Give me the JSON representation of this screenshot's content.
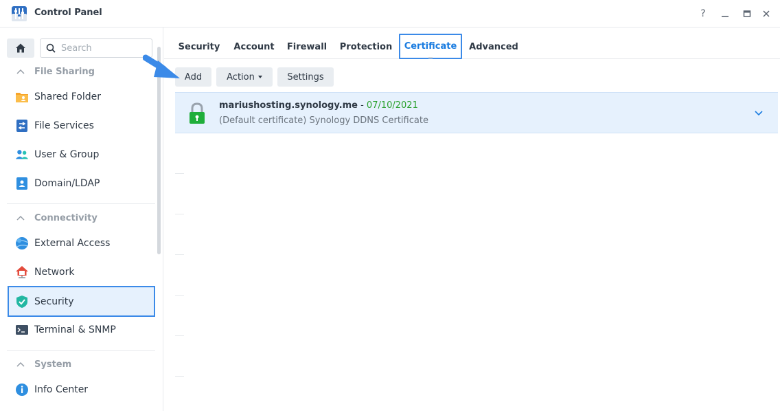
{
  "window": {
    "title": "Control Panel",
    "icon": "control-panel-icon",
    "controls": [
      "help-icon",
      "minimize-icon",
      "maximize-icon",
      "close-icon"
    ]
  },
  "sidebar": {
    "home_icon": "home-icon",
    "search": {
      "placeholder": "Search",
      "value": ""
    },
    "sections": [
      {
        "label": "File Sharing",
        "items": [
          {
            "label": "Shared Folder",
            "icon": "shared-folder-icon"
          },
          {
            "label": "File Services",
            "icon": "file-services-icon"
          },
          {
            "label": "User & Group",
            "icon": "user-group-icon"
          },
          {
            "label": "Domain/LDAP",
            "icon": "domain-ldap-icon"
          }
        ]
      },
      {
        "label": "Connectivity",
        "items": [
          {
            "label": "External Access",
            "icon": "external-access-icon"
          },
          {
            "label": "Network",
            "icon": "network-icon"
          },
          {
            "label": "Security",
            "icon": "security-shield-icon",
            "active": true
          },
          {
            "label": "Terminal & SNMP",
            "icon": "terminal-icon"
          }
        ]
      },
      {
        "label": "System",
        "items": [
          {
            "label": "Info Center",
            "icon": "info-icon"
          }
        ]
      }
    ]
  },
  "tabs": [
    {
      "label": "Security"
    },
    {
      "label": "Account"
    },
    {
      "label": "Firewall"
    },
    {
      "label": "Protection"
    },
    {
      "label": "Certificate",
      "active": true
    },
    {
      "label": "Advanced"
    }
  ],
  "toolbar": {
    "add_label": "Add",
    "action_label": "Action",
    "settings_label": "Settings"
  },
  "certificates": [
    {
      "name": "mariushosting.synology.me",
      "separator": " - ",
      "expiry": "07/10/2021",
      "description": "(Default certificate) Synology DDNS Certificate"
    }
  ],
  "colors": {
    "accent": "#3b8ae8",
    "active_tab_text": "#1a7ce0",
    "selected_row": "#e6f1fd",
    "valid_date": "#2aa12e",
    "lock_green": "#1fae3a"
  }
}
